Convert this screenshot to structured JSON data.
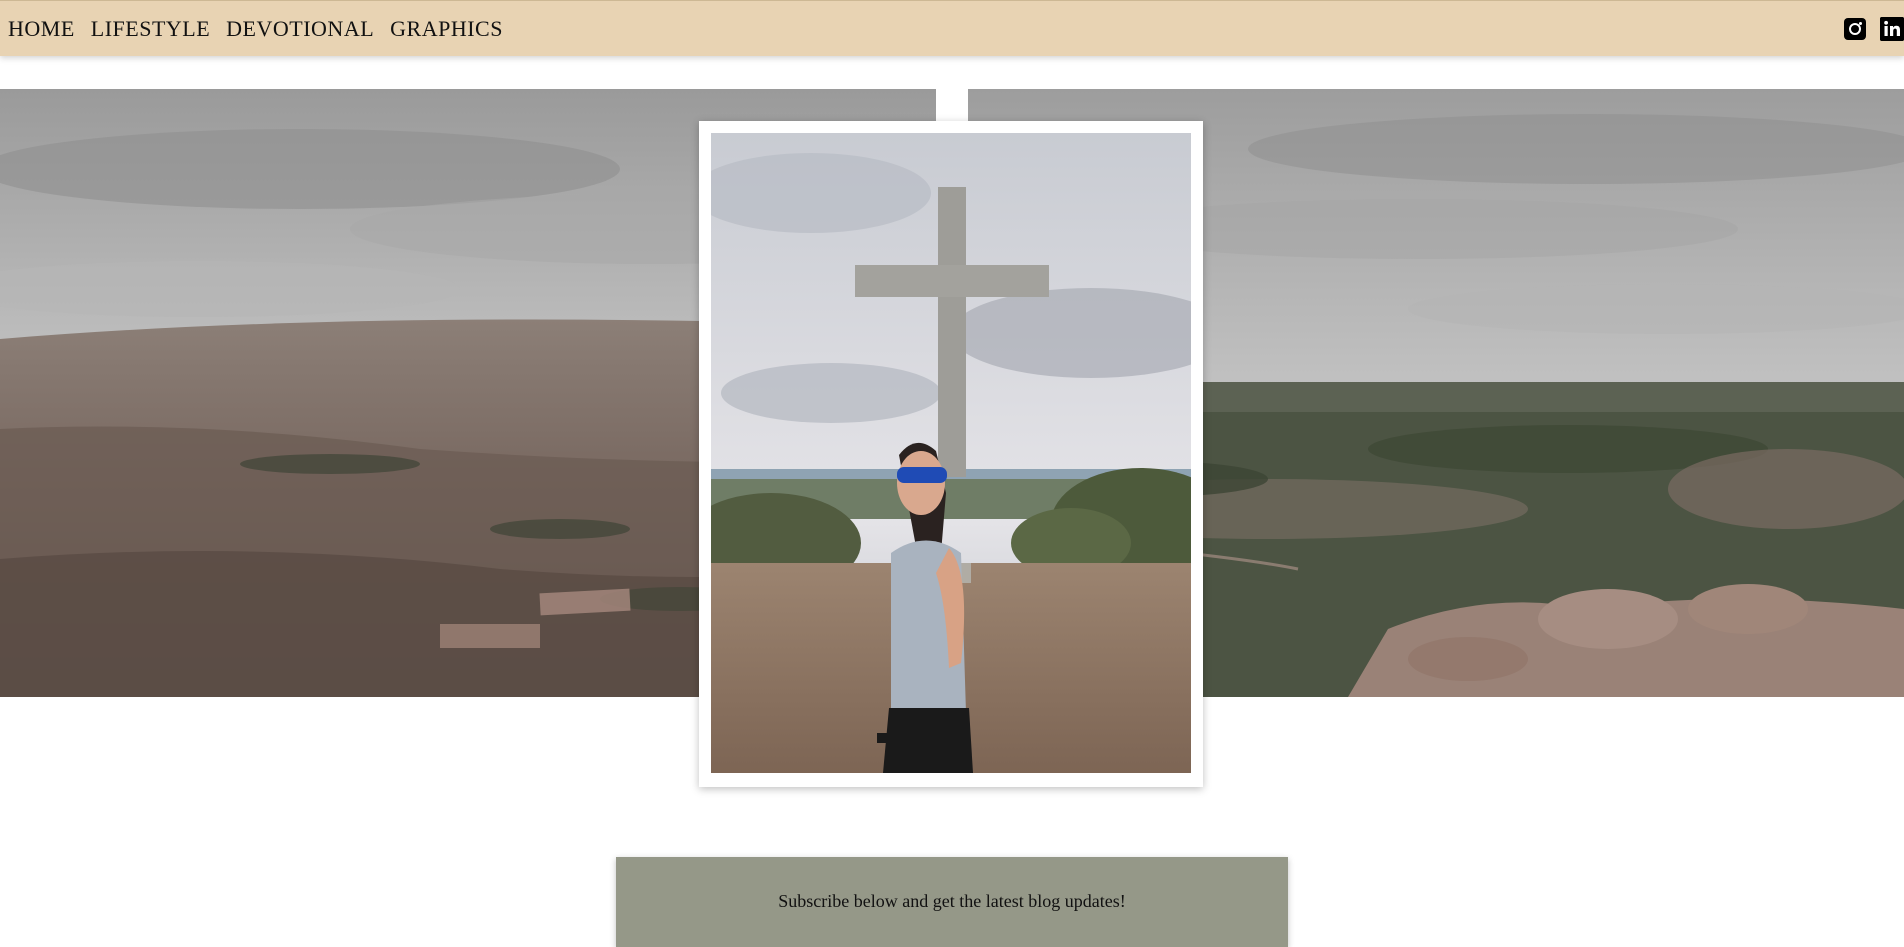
{
  "nav": {
    "items": [
      {
        "label": "HOME"
      },
      {
        "label": "LIFESTYLE"
      },
      {
        "label": "DEVOTIONAL"
      },
      {
        "label": "GRAPHICS"
      }
    ]
  },
  "social": {
    "icons": [
      "instagram-icon",
      "linkedin-icon"
    ]
  },
  "colors": {
    "nav_background": "#e8d3b3",
    "subscribe_background": "#959888"
  },
  "subscribe": {
    "text": "Subscribe below and get the latest blog updates!"
  }
}
